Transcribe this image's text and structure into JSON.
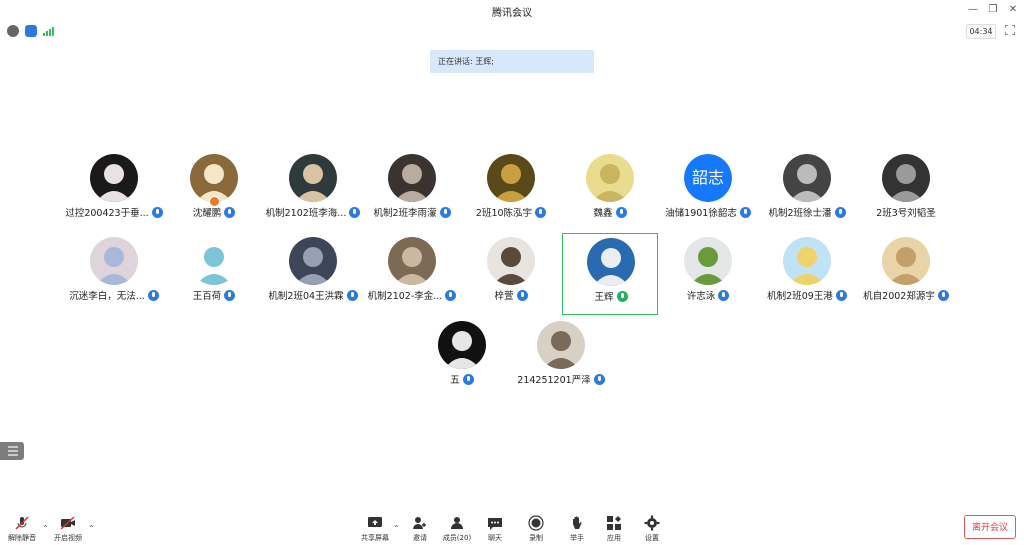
{
  "window": {
    "title": "腾讯会议"
  },
  "status": {
    "timer": "04:34"
  },
  "speaking": "正在讲话: 王辉;",
  "participants": [
    {
      "name": "过控200423于垂...",
      "mic": "on"
    },
    {
      "name": "沈耀鹏",
      "mic": "on"
    },
    {
      "name": "机制2102班李海...",
      "mic": "on"
    },
    {
      "name": "机制2班李雨濛",
      "mic": "on"
    },
    {
      "name": "2班10陈泓宇",
      "mic": "on"
    },
    {
      "name": "魏鑫",
      "mic": "on"
    },
    {
      "name": "油储1901徐韶志",
      "mic": "on",
      "avatar_text": "韶志"
    },
    {
      "name": "机制2班徐士潘",
      "mic": "on"
    },
    {
      "name": "2班3号刘韬圣",
      "mic": "none"
    },
    {
      "name": "沉迷李白，无法...",
      "mic": "on"
    },
    {
      "name": "王百荷",
      "mic": "on"
    },
    {
      "name": "机制2班04王洪霖",
      "mic": "on"
    },
    {
      "name": "机制2102-李金...",
      "mic": "on"
    },
    {
      "name": "梓萱",
      "mic": "on"
    },
    {
      "name": "王辉",
      "mic": "speaking",
      "active": true
    },
    {
      "name": "许志泳",
      "mic": "on"
    },
    {
      "name": "机制2班09王港",
      "mic": "on"
    },
    {
      "name": "机自2002郑源宇",
      "mic": "on"
    },
    {
      "name": "五",
      "mic": "on"
    },
    {
      "name": "214251201严泽",
      "mic": "on"
    }
  ],
  "toolbar": {
    "unmute": "解除静音",
    "video": "开启视频",
    "share": "共享屏幕",
    "invite": "邀请",
    "members": "成员(20)",
    "chat": "聊天",
    "record": "录制",
    "raise_hand": "举手",
    "apps": "应用",
    "settings": "设置",
    "leave": "离开会议"
  },
  "colors": {
    "accent": "#2a7ae2",
    "active_border": "#2fbf5a",
    "leave": "#e04040"
  }
}
